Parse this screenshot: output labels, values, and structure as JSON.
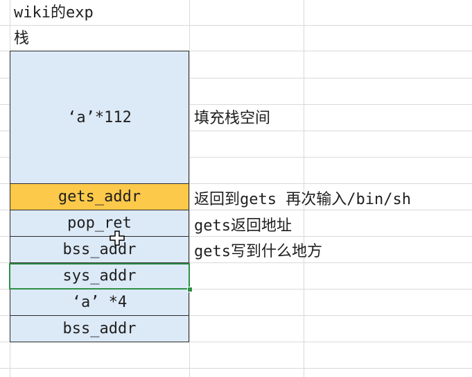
{
  "sheet": {
    "title_cell": "wiki的exp",
    "stack_label": "栈"
  },
  "stack": [
    {
      "label": "‘a’*112",
      "note": "填充栈空间"
    },
    {
      "label": "gets_addr",
      "note": "返回到gets 再次输入/bin/sh",
      "highlight": true
    },
    {
      "label": "pop_ret",
      "note": "gets返回地址"
    },
    {
      "label": "bss_addr",
      "note": "gets写到什么地方"
    },
    {
      "label": "sys_addr",
      "note": ""
    },
    {
      "label": "‘a’ *4",
      "note": ""
    },
    {
      "label": "bss_addr",
      "note": ""
    }
  ],
  "colors": {
    "cell_fill": "#dce9f7",
    "highlight_fill": "#fcc94a",
    "selection_border": "#2f8f46"
  },
  "icons": {
    "cursor": "cross-cursor-icon"
  }
}
